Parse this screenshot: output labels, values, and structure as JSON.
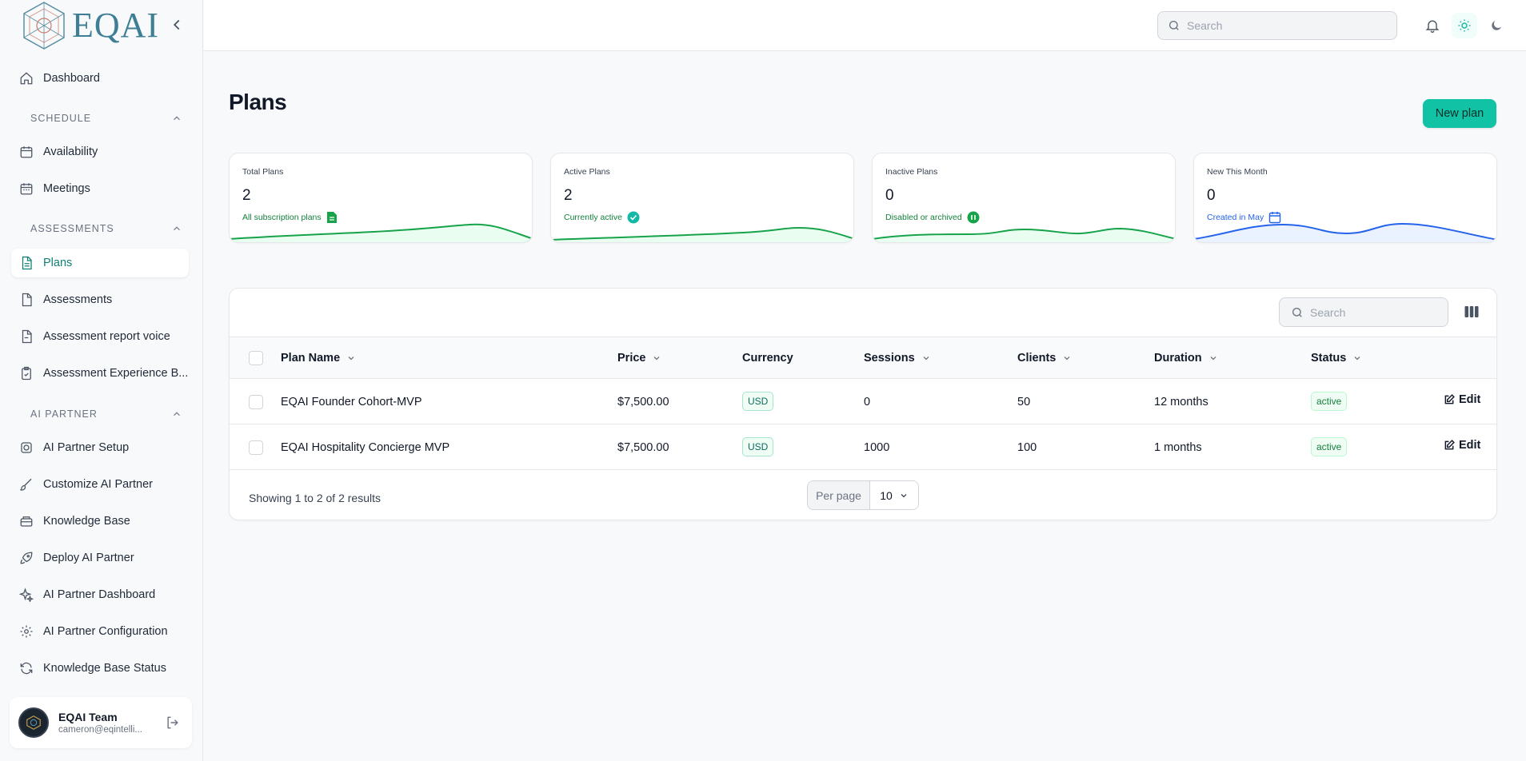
{
  "brand": {
    "logo_text": "EQAI"
  },
  "topbar": {
    "search_placeholder": "Search"
  },
  "sidebar": {
    "dashboard": "Dashboard",
    "sections": {
      "schedule": "SCHEDULE",
      "assessments": "ASSESSMENTS",
      "ai_partner": "AI PARTNER"
    },
    "items": {
      "availability": "Availability",
      "meetings": "Meetings",
      "plans": "Plans",
      "assessments": "Assessments",
      "assessment_report_voice": "Assessment report voice",
      "assessment_experience": "Assessment Experience B...",
      "ai_partner_setup": "AI Partner Setup",
      "customize_ai_partner": "Customize AI Partner",
      "knowledge_base": "Knowledge Base",
      "deploy_ai_partner": "Deploy AI Partner",
      "ai_partner_dashboard": "AI Partner Dashboard",
      "ai_partner_configuration": "AI Partner Configuration",
      "knowledge_base_status": "Knowledge Base Status"
    },
    "user": {
      "name": "EQAI Team",
      "email": "cameron@eqintelli..."
    }
  },
  "page": {
    "title": "Plans",
    "new_button": "New plan"
  },
  "stats": [
    {
      "label": "Total Plans",
      "value": "2",
      "desc": "All subscription plans",
      "color": "#16a34a"
    },
    {
      "label": "Active Plans",
      "value": "2",
      "desc": "Currently active",
      "color": "#16a34a"
    },
    {
      "label": "Inactive Plans",
      "value": "0",
      "desc": "Disabled or archived",
      "color": "#16a34a"
    },
    {
      "label": "New This Month",
      "value": "0",
      "desc": "Created in May",
      "color": "#2563eb"
    }
  ],
  "table": {
    "search_placeholder": "Search",
    "headers": {
      "plan_name": "Plan Name",
      "price": "Price",
      "currency": "Currency",
      "sessions": "Sessions",
      "clients": "Clients",
      "duration": "Duration",
      "status": "Status"
    },
    "rows": [
      {
        "name": "EQAI Founder Cohort-MVP",
        "price": "$7,500.00",
        "currency": "USD",
        "sessions": "0",
        "clients": "50",
        "duration": "12 months",
        "status": "active",
        "action": "Edit"
      },
      {
        "name": "EQAI Hospitality Concierge MVP",
        "price": "$7,500.00",
        "currency": "USD",
        "sessions": "1000",
        "clients": "100",
        "duration": "1 months",
        "status": "active",
        "action": "Edit"
      }
    ],
    "footer": {
      "showing": "Showing 1 to 2 of 2 results",
      "per_page_label": "Per page",
      "per_page_value": "10"
    }
  },
  "colors": {
    "accent": "#12c2a4",
    "active_nav": "#0f7f74"
  }
}
